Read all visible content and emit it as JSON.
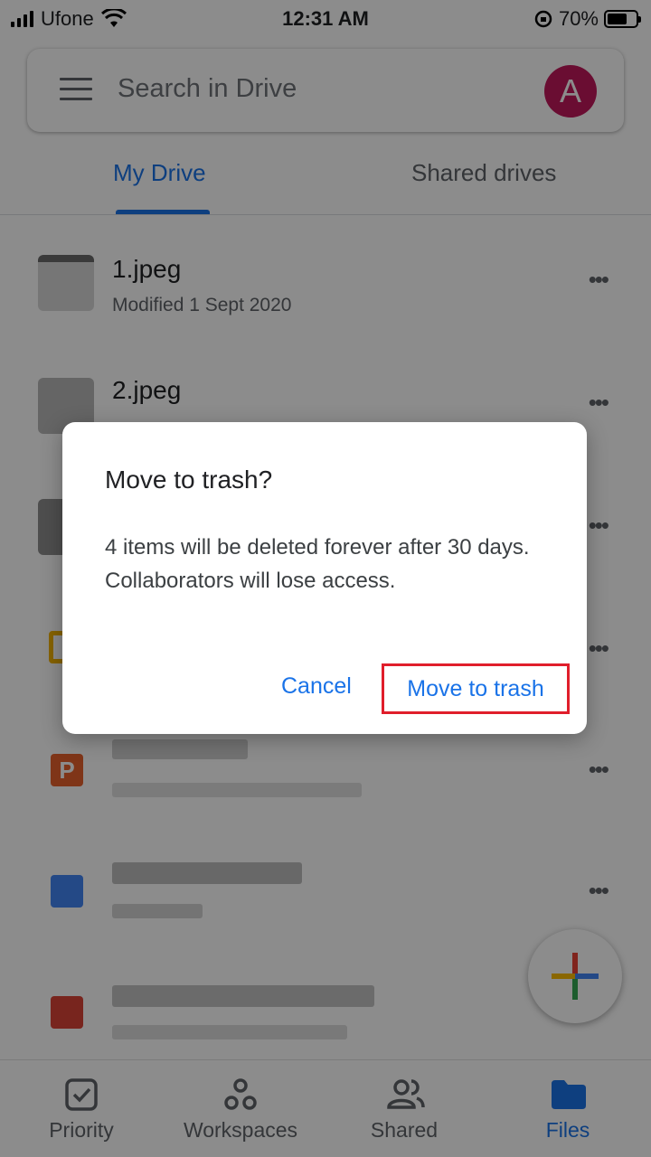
{
  "status_bar": {
    "carrier": "Ufone",
    "time": "12:31 AM",
    "battery": "70%",
    "battery_level": 0.7
  },
  "search": {
    "placeholder": "Search in Drive",
    "avatar_letter": "A"
  },
  "tabs": [
    {
      "label": "My Drive",
      "active": true
    },
    {
      "label": "Shared drives",
      "active": false
    }
  ],
  "files": [
    {
      "name": "1.jpeg",
      "meta": "Modified 1 Sept 2020"
    },
    {
      "name": "2.jpeg",
      "meta": ""
    }
  ],
  "bottom_nav": [
    {
      "label": "Priority",
      "icon": "checkbox-icon"
    },
    {
      "label": "Workspaces",
      "icon": "workspaces-icon"
    },
    {
      "label": "Shared",
      "icon": "people-icon"
    },
    {
      "label": "Files",
      "icon": "folder-icon",
      "active": true
    }
  ],
  "dialog": {
    "title": "Move to trash?",
    "body": "4 items will be deleted forever after 30 days. Collaborators will lose access.",
    "cancel_label": "Cancel",
    "confirm_label": "Move to trash"
  },
  "colors": {
    "accent": "#1a73e8",
    "avatar": "#c2185b",
    "highlight": "#e01e2b"
  }
}
